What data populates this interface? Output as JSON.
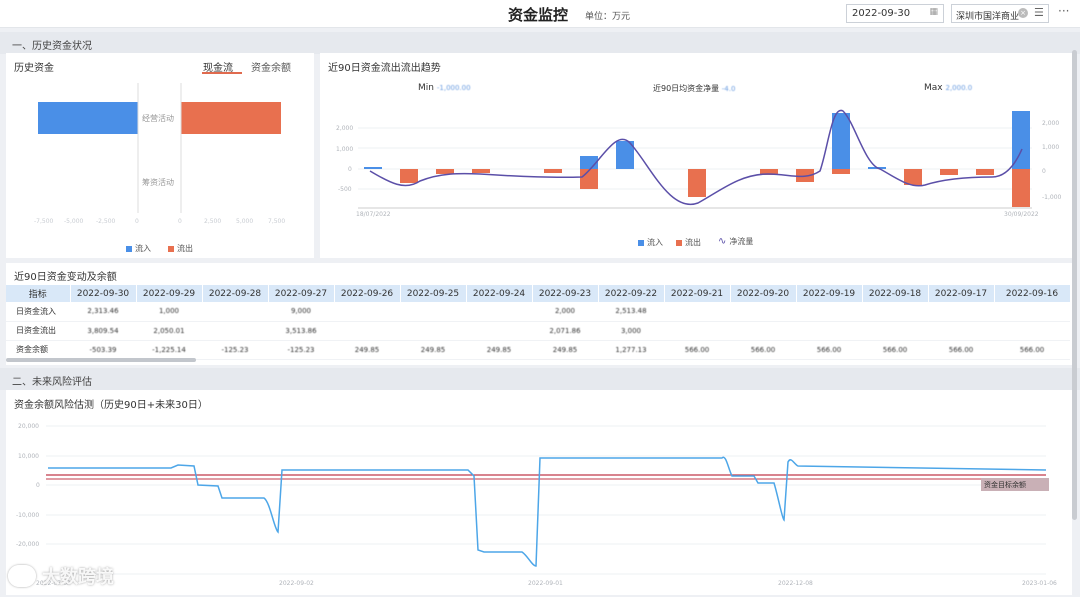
{
  "header": {
    "title": "资金监控",
    "unit": "单位：万元",
    "date_value": "2022-09-30",
    "company": "深圳市国洋商业",
    "more": "···"
  },
  "section1": {
    "title": "一、历史资金状况"
  },
  "history_panel": {
    "title": "历史资金",
    "tabs": [
      {
        "label": "现金流",
        "active": true
      },
      {
        "label": "资金余额",
        "active": false
      }
    ],
    "categories": [
      "经营活动",
      "筹资活动"
    ],
    "legend": {
      "in": "流入",
      "out": "流出"
    }
  },
  "trend_panel": {
    "title": "近90日资金流出流出趋势",
    "min_label": "Min",
    "avg_label": "近90日均资金净量",
    "max_label": "Max",
    "date_start": "18/07/2022",
    "date_end": "30/09/2022",
    "y_ticks": [
      "1,000",
      "0",
      "-500"
    ],
    "legend": {
      "in": "流入",
      "out": "流出",
      "net": "净流量"
    }
  },
  "table_panel": {
    "title": "近90日资金变动及余额",
    "header_label": "指标",
    "dates": [
      "2022-09-30",
      "2022-09-29",
      "2022-09-28",
      "2022-09-27",
      "2022-09-26",
      "2022-09-25",
      "2022-09-24",
      "2022-09-23",
      "2022-09-22",
      "2022-09-21",
      "2022-09-20",
      "2022-09-19",
      "2022-09-18",
      "2022-09-17",
      "2022-09-16"
    ],
    "rows": [
      {
        "label": "日资金流入",
        "values": [
          "2,313.46",
          "1,000",
          "",
          "9,000",
          "",
          "",
          "",
          "2,000",
          "2,513.48",
          "",
          "",
          "",
          "",
          "",
          ""
        ]
      },
      {
        "label": "日资金流出",
        "values": [
          "3,809.54",
          "2,050.01",
          "",
          "3,513.86",
          "",
          "",
          "",
          "2,071.86",
          "3,000",
          "",
          "",
          "",
          "",
          "",
          ""
        ]
      },
      {
        "label": "资金余额",
        "values": [
          "-503.39",
          "-1,225.14",
          "-125.23",
          "-125.23",
          "249.85",
          "249.85",
          "249.85",
          "249.85",
          "1,277.13",
          "566.00",
          "566.00",
          "566.00",
          "566.00",
          "566.00",
          "566.00"
        ]
      }
    ]
  },
  "section2": {
    "title": "二、未来风险评估"
  },
  "risk_panel": {
    "title": "资金余额风险估测（历史90日+未来30日）",
    "x_ticks": [
      "2022-07-03",
      "2022-09-02",
      "2022-09-01",
      "2022-12-08",
      "2023-01-06"
    ],
    "y_ticks": [
      "20,000",
      "10,000",
      "0",
      "-10,000",
      "-20,000"
    ],
    "threshold_label": "资金目标余额"
  },
  "watermark": "大数跨境",
  "colors": {
    "inflow": "#4a8fe7",
    "outflow": "#e8704f",
    "net": "#5b4fa8",
    "risk_line": "#4da6e8",
    "threshold": "#c0394a"
  }
}
